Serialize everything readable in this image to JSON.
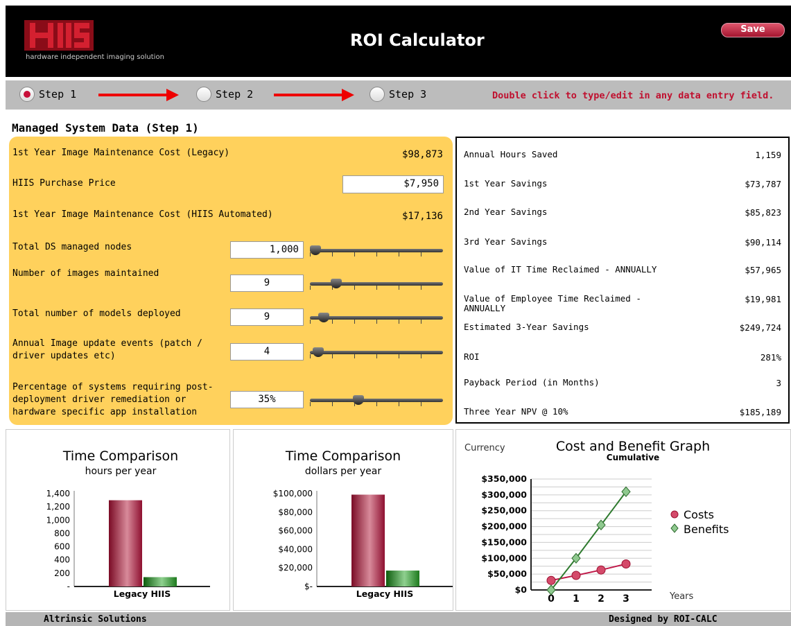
{
  "header": {
    "logo_text": "HIIS",
    "logo_tagline": "hardware independent imaging solution",
    "title": "ROI Calculator",
    "save_label": "Save"
  },
  "steps": [
    {
      "label": "Step 1",
      "selected": true
    },
    {
      "label": "Step 2",
      "selected": false
    },
    {
      "label": "Step 3",
      "selected": false
    }
  ],
  "hint": "Double click to type/edit in any data entry field.",
  "section_title": "Managed System Data (Step 1)",
  "inputs": {
    "legacy_cost_label": "1st Year Image Maintenance Cost (Legacy)",
    "legacy_cost_value": "$98,873",
    "purchase_price_label": "HIIS Purchase Price",
    "purchase_price_value": "$7,950",
    "automated_cost_label": "1st Year Image Maintenance Cost (HIIS Automated)",
    "automated_cost_value": "$17,136",
    "sliders": [
      {
        "label": "Total DS managed nodes",
        "value": "1,000",
        "level": 0.0
      },
      {
        "label": "Number of images maintained",
        "value": "9",
        "level": 0.17
      },
      {
        "label": "Total number of models deployed",
        "value": "9",
        "level": 0.07
      },
      {
        "label": "Annual Image update events (patch / driver updates etc)",
        "value": "4",
        "level": 0.02
      },
      {
        "label": "Percentage of systems requiring post-deployment driver remediation or hardware specific app installation",
        "value": "35%",
        "level": 0.35
      }
    ]
  },
  "results": [
    {
      "label": "Annual Hours Saved",
      "value": "1,159"
    },
    {
      "label": "1st Year Savings",
      "value": "$73,787"
    },
    {
      "label": "2nd Year Savings",
      "value": "$85,823"
    },
    {
      "label": "3rd Year Savings",
      "value": "$90,114"
    },
    {
      "label": "Value of IT Time Reclaimed - ANNUALLY",
      "value": "$57,965"
    },
    {
      "label": "Value of Employee Time Reclaimed - ANNUALLY",
      "value": "$19,981"
    },
    {
      "label": "Estimated 3-Year Savings",
      "value": "$249,724"
    },
    {
      "label": "ROI",
      "value": "281%"
    },
    {
      "label": "Payback Period (in Months)",
      "value": "3"
    },
    {
      "label": "Three Year NPV @ 10%",
      "value": "$185,189"
    }
  ],
  "colors": {
    "accent_red": "#c0102f",
    "panel_yellow": "#ffd15c",
    "legacy_bar": "#8e1030",
    "hiis_bar": "#1d7a1d"
  },
  "chart_data": [
    {
      "type": "bar",
      "title": "Time Comparison",
      "subtitle": "hours per year",
      "categories": [
        "Legacy",
        "HIIS"
      ],
      "values": [
        1300,
        141
      ],
      "ylim": [
        0,
        1400
      ],
      "yticks": [
        "1,400",
        "1,200",
        "1,000",
        "800",
        "600",
        "400",
        "200",
        "-"
      ]
    },
    {
      "type": "bar",
      "title": "Time Comparison",
      "subtitle": "dollars per year",
      "categories": [
        "Legacy",
        "HIIS"
      ],
      "values": [
        98873,
        17136
      ],
      "ylim": [
        0,
        100000
      ],
      "yticks": [
        "$100,000",
        "$80,000",
        "$60,000",
        "$40,000",
        "$20,000",
        "$-"
      ]
    },
    {
      "type": "line",
      "title": "Cost and Benefit Graph",
      "subtitle": "Cumulative",
      "ylabel": "Currency",
      "xlabel": "Years",
      "x": [
        0,
        1,
        2,
        3
      ],
      "ylim": [
        0,
        350000
      ],
      "yticks": [
        "$350,000",
        "$300,000",
        "$250,000",
        "$200,000",
        "$150,000",
        "$100,000",
        "$50,000",
        "$0"
      ],
      "series": [
        {
          "name": "Costs",
          "values": [
            30000,
            46000,
            63000,
            82000
          ]
        },
        {
          "name": "Benefits",
          "values": [
            0,
            100000,
            205000,
            310000
          ]
        }
      ]
    }
  ],
  "footer": {
    "left": "Altrinsic Solutions",
    "right": "Designed by ROI-CALC"
  }
}
